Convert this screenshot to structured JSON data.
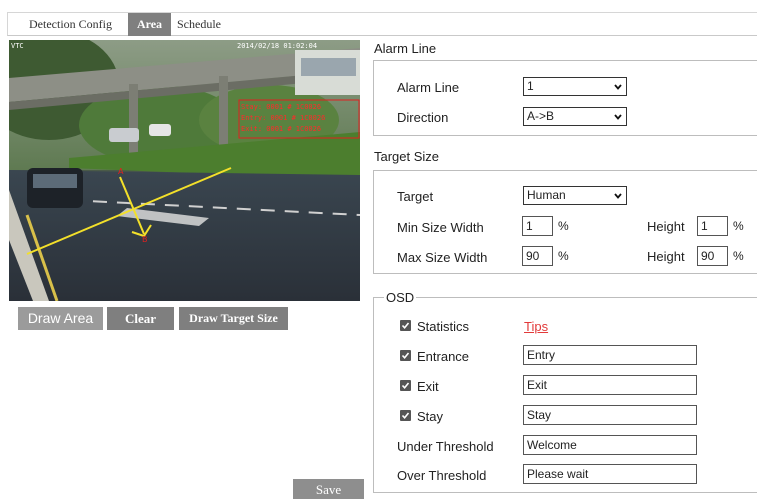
{
  "tabs": [
    {
      "label": "Detection Config",
      "active": false
    },
    {
      "label": "Area",
      "active": true
    },
    {
      "label": "Schedule",
      "active": false
    }
  ],
  "video": {
    "corner_text": "VTC",
    "timestamp": "2014/02/18 01:02:04",
    "overlay_lines": [
      "Stay: 0001  # 1C0026",
      "Entry: 0001  # 1C0026",
      "Exit: 0001  # 1C0026"
    ]
  },
  "left_buttons": {
    "draw_area": "Draw Area",
    "clear": "Clear",
    "draw_target_size": "Draw Target Size",
    "save": "Save"
  },
  "alarm_line": {
    "section_title": "Alarm Line",
    "line_label": "Alarm Line",
    "line_value": "1",
    "direction_label": "Direction",
    "direction_value": "A->B"
  },
  "target_size": {
    "section_title": "Target Size",
    "target_label": "Target",
    "target_value": "Human",
    "min_label": "Min Size Width",
    "min_width": "1",
    "min_height": "1",
    "max_label": "Max Size Width",
    "max_width": "90",
    "max_height": "90",
    "height_label": "Height",
    "percent": "%"
  },
  "osd": {
    "legend": "OSD",
    "tips": "Tips",
    "statistics_label": "Statistics",
    "statistics_checked": true,
    "entrance_label": "Entrance",
    "entrance_checked": true,
    "entrance_value": "Entry",
    "exit_label": "Exit",
    "exit_checked": true,
    "exit_value": "Exit",
    "stay_label": "Stay",
    "stay_checked": true,
    "stay_value": "Stay",
    "under_label": "Under Threshold",
    "under_value": "Welcome",
    "over_label": "Over Threshold",
    "over_value": "Please wait"
  },
  "colors": {
    "tab_active": "#7f7f7f",
    "button_gray": "#7f7f7f",
    "tips_red": "#e23a3a",
    "alarm_line_yellow": "#f3e02a",
    "overlay_red": "#e02020"
  },
  "icons": {
    "select_arrow": "chevron-down-icon",
    "checkbox": "checkmark-icon"
  }
}
